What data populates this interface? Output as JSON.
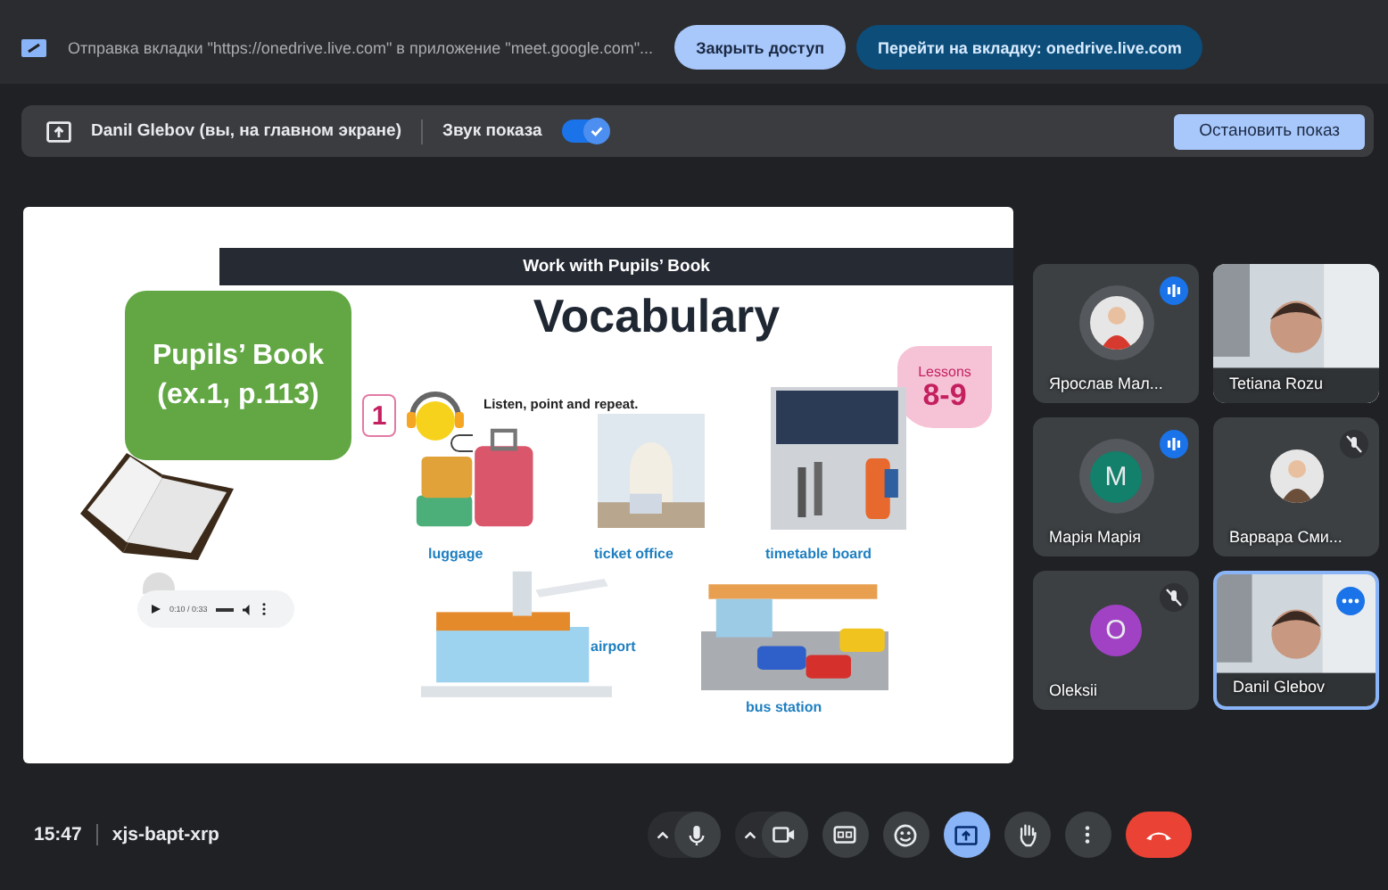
{
  "infobar": {
    "message": "Отправка вкладки \"https://onedrive.live.com\" в приложение \"meet.google.com\"...",
    "buttons": [
      {
        "label": "Закрыть доступ",
        "kind": "light"
      },
      {
        "label": "Перейти на вкладку: onedrive.live.com",
        "kind": "dark"
      }
    ]
  },
  "presenting_bar": {
    "presenter": "Danil Glebov (вы, на главном экране)",
    "audio_label": "Звук показа",
    "audio_on": true,
    "stop_button": "Остановить показ"
  },
  "slide": {
    "header": "Work with Pupils’ Book",
    "title": "Vocabulary",
    "book_box": [
      "Pupils’ Book",
      "(ex.1, p.113)"
    ],
    "audio_time": "0:10 / 0:33",
    "lessons_label": "Lessons",
    "lessons_number": "8-9",
    "exercise_number": "1",
    "instruction": "Listen, point and repeat.",
    "words": [
      {
        "kind": "luggage",
        "label": "luggage"
      },
      {
        "kind": "ticket",
        "label": "ticket office"
      },
      {
        "kind": "timetable",
        "label": "timetable board"
      },
      {
        "kind": "airport",
        "label": "airport"
      },
      {
        "kind": "bus",
        "label": "bus station"
      }
    ]
  },
  "participants": [
    {
      "name": "Ярослав Мал...",
      "speaking": true,
      "muted": false,
      "active": false
    },
    {
      "name": "Tetiana Rozu",
      "kind": "video",
      "speaking": false,
      "muted": false,
      "active": false
    },
    {
      "name": "Марія Марія",
      "kind": "letter",
      "letter": "M",
      "color": "#12806a",
      "speaking": true,
      "muted": false,
      "active": false
    },
    {
      "name": "Варвара Сми...",
      "speaking": false,
      "muted": true,
      "active": false
    },
    {
      "name": "Oleksii",
      "kind": "letter",
      "letter": "O",
      "color": "#a142c4",
      "speaking": false,
      "muted": true,
      "active": false
    },
    {
      "name": "Danil Glebov",
      "kind": "video",
      "speaking": false,
      "muted": false,
      "active": true
    }
  ],
  "footer": {
    "time": "15:47",
    "meeting_code": "xjs-bapt-xrp",
    "controls": [
      {
        "kind": "mic",
        "selected": false
      },
      {
        "kind": "camera",
        "selected": false
      },
      {
        "kind": "captions",
        "selected": false
      },
      {
        "kind": "emoji",
        "selected": false
      },
      {
        "kind": "present",
        "selected": true
      },
      {
        "kind": "hand",
        "selected": false
      },
      {
        "kind": "more",
        "selected": false
      },
      {
        "kind": "end",
        "selected": false
      }
    ]
  }
}
